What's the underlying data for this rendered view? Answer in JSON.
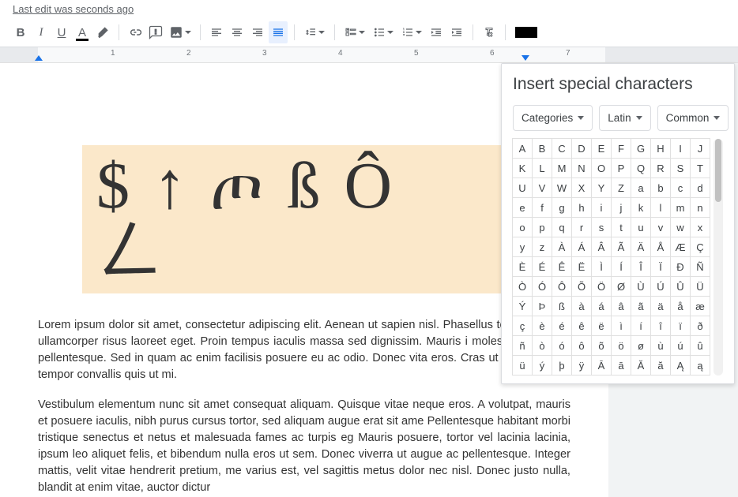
{
  "status": {
    "last_edit": "Last edit was seconds ago"
  },
  "toolbar": {},
  "ruler": {
    "labels": [
      "1",
      "2",
      "3",
      "4",
      "5",
      "6",
      "7"
    ]
  },
  "doc": {
    "symbol_box": "$↑ጦßÔㄥ",
    "para1": "Lorem ipsum dolor sit amet, consectetur adipiscing elit. Aenean ut sapien nisl. Phasellus tempor leo, ac ullamcorper risus laoreet eget. Proin tempus iaculis massa sed dignissim. Mauris i molestie ut velit eu pellentesque. Sed in quam ac enim facilisis posuere eu ac odio. Donec vita eros. Cras ut est nec tellus tempor convallis quis ut mi.",
    "para2": "Vestibulum elementum nunc sit amet consequat aliquam. Quisque vitae neque eros. A volutpat, mauris et posuere iaculis, nibh purus cursus tortor, sed aliquam augue erat sit ame Pellentesque habitant morbi tristique senectus et netus et malesuada fames ac turpis eg Mauris posuere, tortor vel lacinia lacinia, ipsum leo aliquet felis, et bibendum nulla eros ut sem. Donec viverra ut augue ac pellentesque. Integer mattis, velit vitae hendrerit pretium, me varius est, vel sagittis metus dolor nec nisl. Donec justo nulla, blandit at enim vitae, auctor dictur"
  },
  "panel": {
    "title": "Insert special characters",
    "dd1": "Categories",
    "dd2": "Latin",
    "dd3": "Common",
    "chars": [
      "A",
      "B",
      "C",
      "D",
      "E",
      "F",
      "G",
      "H",
      "I",
      "J",
      "K",
      "L",
      "M",
      "N",
      "O",
      "P",
      "Q",
      "R",
      "S",
      "T",
      "U",
      "V",
      "W",
      "X",
      "Y",
      "Z",
      "a",
      "b",
      "c",
      "d",
      "e",
      "f",
      "g",
      "h",
      "i",
      "j",
      "k",
      "l",
      "m",
      "n",
      "o",
      "p",
      "q",
      "r",
      "s",
      "t",
      "u",
      "v",
      "w",
      "x",
      "y",
      "z",
      "À",
      "Á",
      "Â",
      "Ã",
      "Ä",
      "Å",
      "Æ",
      "Ç",
      "È",
      "É",
      "Ê",
      "Ë",
      "Ì",
      "Í",
      "Î",
      "Ï",
      "Ð",
      "Ñ",
      "Ò",
      "Ó",
      "Ô",
      "Õ",
      "Ö",
      "Ø",
      "Ù",
      "Ú",
      "Û",
      "Ü",
      "Ý",
      "Þ",
      "ß",
      "à",
      "á",
      "â",
      "ã",
      "ä",
      "å",
      "æ",
      "ç",
      "è",
      "é",
      "ê",
      "ë",
      "ì",
      "í",
      "î",
      "ï",
      "ð",
      "ñ",
      "ò",
      "ó",
      "ô",
      "õ",
      "ö",
      "ø",
      "ù",
      "ú",
      "û",
      "ü",
      "ý",
      "þ",
      "ÿ",
      "Ā",
      "ā",
      "Ă",
      "ă",
      "Ą",
      "ą"
    ]
  }
}
